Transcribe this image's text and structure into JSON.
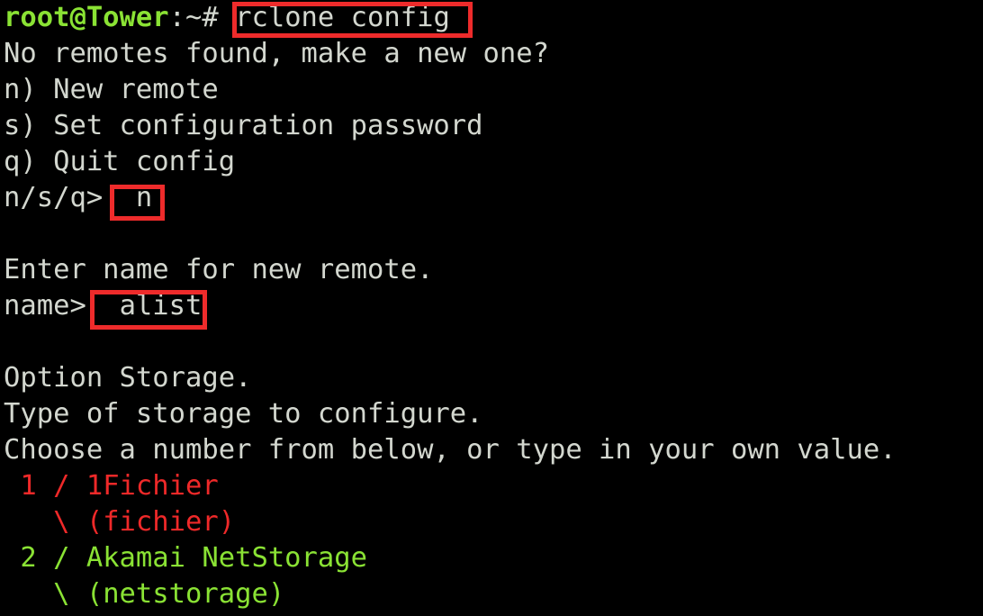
{
  "terminal": {
    "background_color": "#000000",
    "text_color": "#d3d7cf",
    "green_color": "#8ae234",
    "red_color": "#ef2929",
    "highlight_box_color": "#ee2b2b",
    "prompt": {
      "user_host": "root@Tower",
      "path_symbol": ":~#",
      "command": "rclone config"
    },
    "lines": {
      "l1_no_remotes": "No remotes found, make a new one?",
      "l2_new_remote": "n) New remote",
      "l3_set_password": "s) Set configuration password",
      "l4_quit_config": "q) Quit config",
      "l5_prompt_label": "n/s/q>",
      "l5_answer": "n",
      "l6_blank": "",
      "l7_enter_name": "Enter name for new remote.",
      "l8_name_label": "name>",
      "l8_answer": "alist",
      "l9_blank": "",
      "l10_option_storage": "Option Storage.",
      "l11_type_of_storage": "Type of storage to configure.",
      "l12_choose_number": "Choose a number from below, or type in your own value."
    },
    "storage_options": [
      {
        "number": " 1 /",
        "name": "1Fichier",
        "slash": "   \\",
        "value": "(fichier)",
        "color": "#ef2929"
      },
      {
        "number": " 2 /",
        "name": "Akamai NetStorage",
        "slash": "   \\",
        "value": "(netstorage)",
        "color": "#8ae234"
      }
    ],
    "annotations": [
      {
        "label": "command-highlight",
        "target": "rclone config"
      },
      {
        "label": "answer-highlight",
        "target": "n"
      },
      {
        "label": "name-highlight",
        "target": "alist"
      }
    ]
  }
}
